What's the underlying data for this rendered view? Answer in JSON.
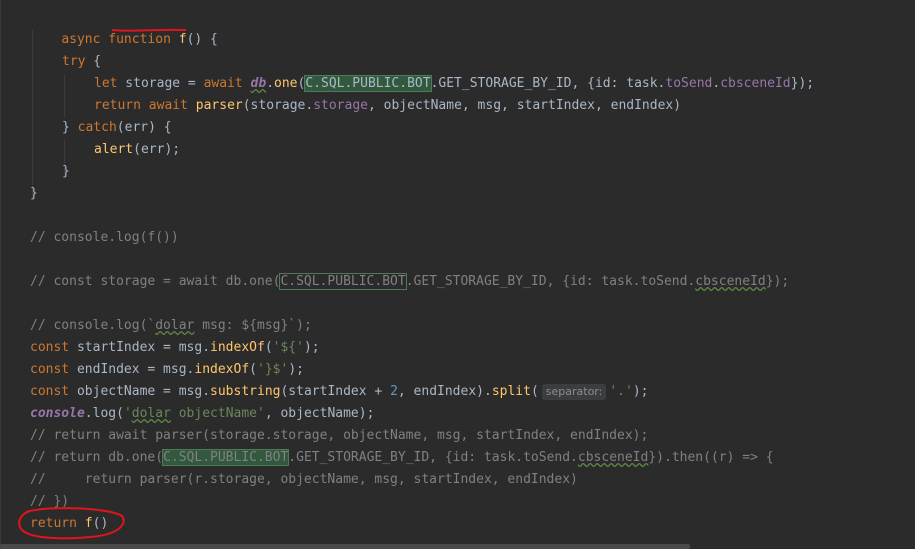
{
  "code": {
    "l1": {
      "k1": "async",
      "k2": "function",
      "name": "f",
      "rest": "() {"
    },
    "l3": {
      "k": "try",
      "rest": " {"
    },
    "l4": {
      "k": "let",
      "p1": " storage = ",
      "k2": "await",
      "db": "db",
      "p2": ".",
      "one": "one",
      "p3": "(",
      "C": "C.SQL.PUBLIC.BOT",
      "p4": ".",
      "g": "GET_STORAGE_BY_ID",
      "p5": ", {id: task.",
      "ts": "toSend",
      "p6": ".",
      "cb": "cbsceneId",
      "p7": "});"
    },
    "l5": {
      "k": "return",
      "sp": " ",
      "k2": "await",
      "sp2": " ",
      "fn": "parser",
      "p1": "(storage.",
      "st": "storage",
      "p2": ", objectName, msg, startIndex, endIndex)"
    },
    "l6": {
      "p1": "} ",
      "k": "catch",
      "p2": "(err) {"
    },
    "l7": {
      "fn": "alert",
      "p1": "(err);"
    },
    "l8": "}",
    "l9": "}",
    "l11": "// console.log(f())",
    "l13": {
      "a": "// const storage = await db.one(",
      "C": "C.SQL.PUBLIC.BOT",
      "b": ".GET_STORAGE_BY_ID, {id: task.toSend.",
      "cb": "cbsceneId",
      "c": "});"
    },
    "l15": {
      "a": "// console.log(`",
      "d": "dolar",
      "b": " msg: ${msg}`);"
    },
    "l16": {
      "k": "const",
      "p1": " startIndex = msg.",
      "fn": "indexOf",
      "p2": "(",
      "s": "'${'",
      "p3": ");"
    },
    "l17": {
      "k": "const",
      "p1": " endIndex = msg.",
      "fn": "indexOf",
      "p2": "(",
      "s": "'}$'",
      "p3": ");"
    },
    "l18": {
      "k": "const",
      "p1": " objectName = msg.",
      "fn": "substring",
      "p2": "(startIndex + ",
      "n": "2",
      "p3": ", endIndex).",
      "fn2": "split",
      "p4": "(",
      "hint": "separator:",
      "s": "'.'",
      "p5": ");"
    },
    "l19": {
      "c": "console",
      "p1": ".log(",
      "s1": "'",
      "d": "dolar",
      "s2": " objectName'",
      "p2": ", objectName);"
    },
    "l20": "// return await parser(storage.storage, objectName, msg, startIndex, endIndex);",
    "l21": {
      "a": "// return db.one(",
      "C": "C.SQL.PUBLIC.BOT",
      "b": ".GET_STORAGE_BY_ID, {id: task.toSend.",
      "cb": "cbsceneId",
      "c": "}).then((r) => {"
    },
    "l22": "//     return parser(r.storage, objectName, msg, startIndex, endIndex)",
    "l23": "// })",
    "l24": {
      "k": "return",
      "sp": " ",
      "fn": "f",
      "p": "()"
    }
  },
  "colors": {
    "background": "#2b2b2b",
    "keyword": "#cc7832",
    "function": "#ffc66d",
    "property": "#9876aa",
    "string": "#6a8759",
    "comment": "#808080",
    "highlight": "#32593d",
    "annotation": "#e0141b"
  }
}
